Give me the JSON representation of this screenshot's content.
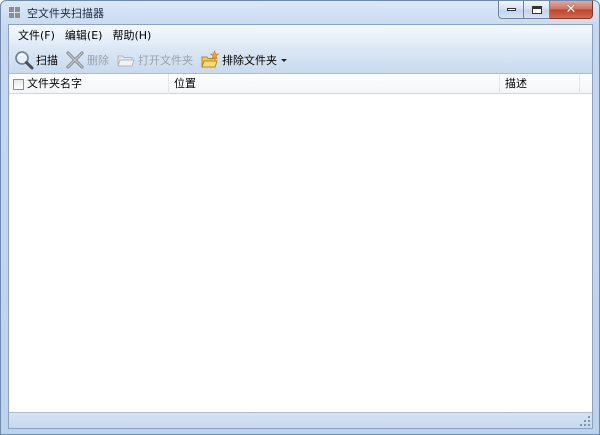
{
  "window": {
    "title": "空文件夹扫描器"
  },
  "menu": {
    "items": [
      {
        "label": "文件(F)"
      },
      {
        "label": "编辑(E)"
      },
      {
        "label": "帮助(H)"
      }
    ]
  },
  "toolbar": {
    "buttons": [
      {
        "label": "扫描",
        "icon": "magnifier-icon",
        "enabled": true
      },
      {
        "label": "删除",
        "icon": "delete-x-icon",
        "enabled": false
      },
      {
        "label": "打开文件夹",
        "icon": "open-folder-icon",
        "enabled": false
      },
      {
        "label": "排除文件夹",
        "icon": "exclude-folder-icon",
        "enabled": true,
        "dropdown": true
      }
    ]
  },
  "list": {
    "columns": [
      {
        "label": "文件夹名字"
      },
      {
        "label": "位置"
      },
      {
        "label": "描述"
      }
    ],
    "rows": []
  },
  "colors": {
    "frame": "#c4d8f0",
    "close_button": "#c0432c",
    "disabled_text": "#9aa3ad"
  }
}
